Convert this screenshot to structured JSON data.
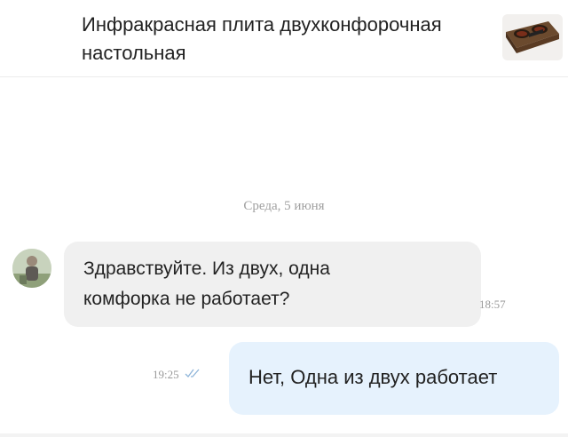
{
  "header": {
    "product_title": "Инфракрасная плита двухконфорочная настольная",
    "product_thumb_icon": "stove-thumbnail-icon"
  },
  "chat": {
    "date_separator": "Среда, 5 июня",
    "messages": [
      {
        "direction": "incoming",
        "text": "Здравствуйте. Из двух, одна комфорка не работает?",
        "time": "18:57"
      },
      {
        "direction": "outgoing",
        "text": "Нет, Одна из двух работает",
        "time": "19:25",
        "status_icon": "double-check-icon"
      }
    ]
  },
  "colors": {
    "incoming_bubble": "#f0f0f0",
    "outgoing_bubble": "#e6f2fd",
    "timestamp": "#9a9a9a",
    "read_check": "#8fb5d9"
  }
}
